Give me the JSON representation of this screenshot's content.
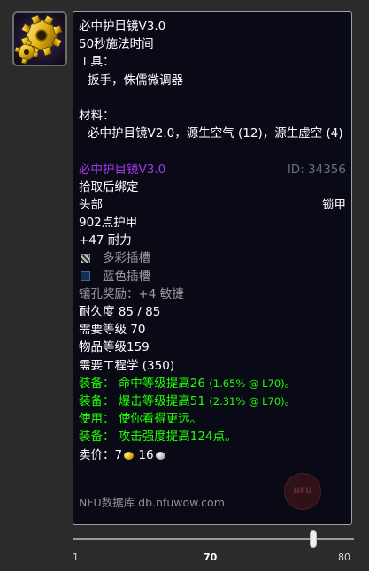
{
  "spell": {
    "title": "必中护目镜V3.0",
    "cast_time": "50秒施法时间",
    "tools_label": "工具：",
    "tools": "扳手，侏儒微调器",
    "materials_label": "材料：",
    "materials": "必中护目镜V2.0，源生空气 (12)，源生虚空 (4)"
  },
  "item": {
    "name": "必中护目镜V3.0",
    "id_text": "ID: 34356",
    "bind": "拾取后绑定",
    "slot": "头部",
    "armor_type": "锁甲",
    "armor": "902点护甲",
    "stamina": "+47 耐力",
    "socket_prismatic": "多彩插槽",
    "socket_blue": "蓝色插槽",
    "socket_bonus": "镶孔奖励：+4 敏捷",
    "durability": "耐久度 85 / 85",
    "req_level": "需要等级 70",
    "item_level": "物品等级159",
    "req_skill": "需要工程学 (350)",
    "equip1_label": "装备：",
    "equip1_text": "命中等级提高26",
    "equip1_pct": "(1.65% @ L70)。",
    "equip2_label": "装备：",
    "equip2_text": "爆击等级提高51",
    "equip2_pct": "(2.31% @ L70)。",
    "use_label": "使用：",
    "use_text": "使你看得更远。",
    "equip3_label": "装备：",
    "equip3_text": "攻击强度提高124点。",
    "sell_label": "卖价：",
    "sell_gold": "7",
    "sell_silver": "16"
  },
  "footer": {
    "text": "NFU数据库 db.nfuwow.com",
    "watermark": "NFU"
  },
  "slider": {
    "min": "1",
    "current": "70",
    "max": "80",
    "fraction": 0.873
  },
  "colors": {
    "epic": "#a335ee",
    "green": "#1eff00",
    "grey": "#9d9d9d",
    "bg": "#0a0a17"
  },
  "icons": [
    "gear-cog-icon",
    "prismatic-socket-icon",
    "blue-socket-icon",
    "gold-coin-icon",
    "silver-coin-icon"
  ]
}
